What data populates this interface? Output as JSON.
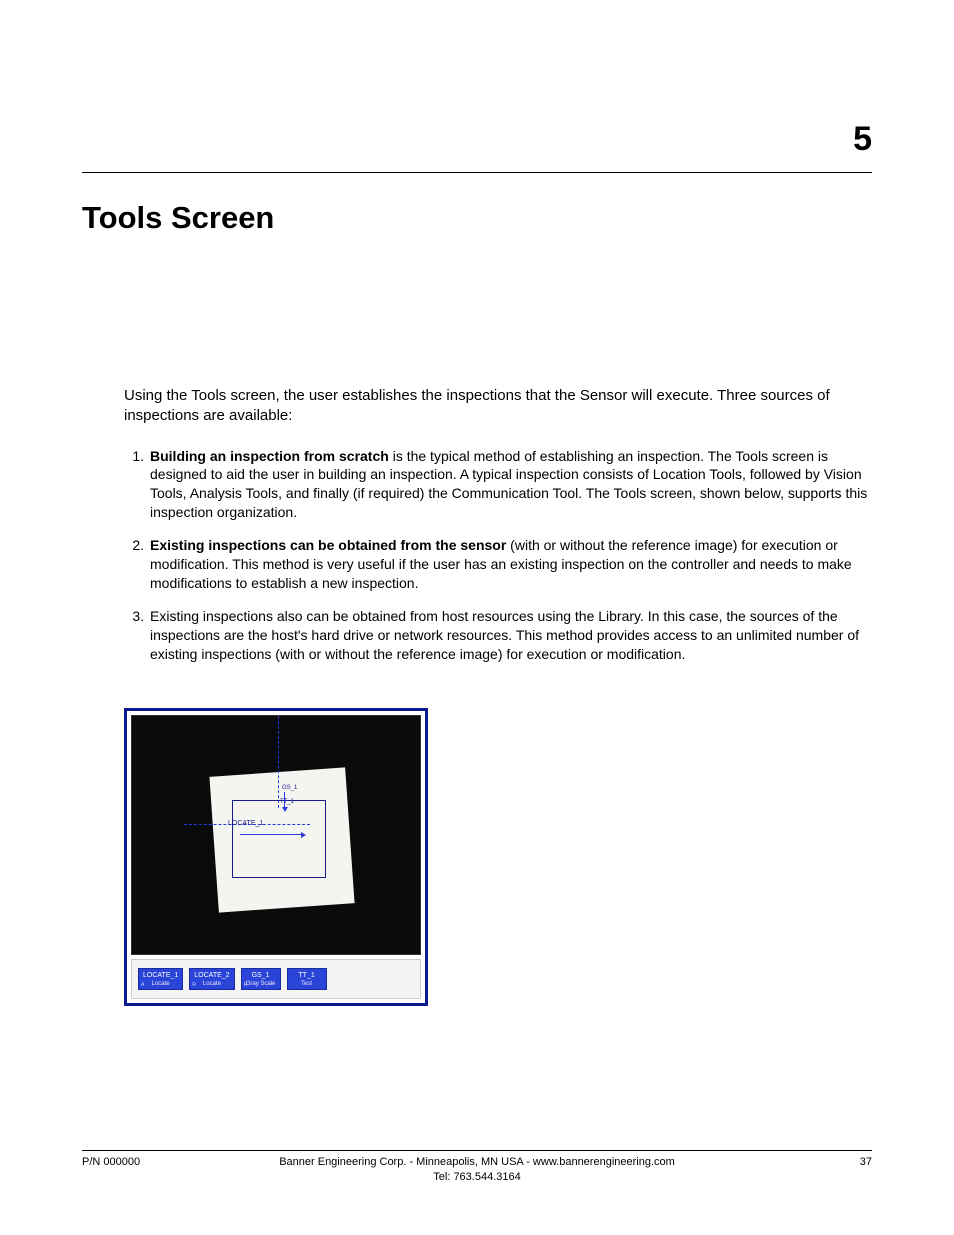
{
  "chapter_number": "5",
  "heading": "Tools Screen",
  "intro": "Using the Tools screen, the user establishes the inspections that the Sensor will execute. Three sources of inspections are available:",
  "sources": [
    {
      "bold": "Building an inspection from scratch",
      "rest": " is the typical method of establishing an inspection. The Tools screen is designed to aid the user in building an inspection. A typical inspection consists of Location Tools, followed by Vision Tools, Analysis Tools, and finally (if required) the Communication Tool. The Tools screen, shown below, supports this inspection organization."
    },
    {
      "bold": "Existing inspections can be obtained from the sensor",
      "rest": " (with or without the reference image) for execution or modification. This method is very useful if the user has an existing inspection on the controller and needs to make modifications to establish a new inspection."
    },
    {
      "bold": "",
      "rest": "Existing inspections also can be obtained from host resources using the Library. In this case, the sources of the inspections are the host's hard drive or network resources. This method provides access to an unlimited number of existing inspections (with or without the reference image) for execution or modification."
    }
  ],
  "figure": {
    "overlay_labels": {
      "locate": "LOCATE_1",
      "gs": "GS_1",
      "tt": "TT_1"
    },
    "tool_buttons": [
      {
        "name": "LOCATE_1",
        "sub": "Locate",
        "corner": "A"
      },
      {
        "name": "LOCATE_2",
        "sub": "Locate",
        "corner": "R"
      },
      {
        "name": "GS_1",
        "sub": "Gray Scale",
        "corner": "R"
      },
      {
        "name": "TT_1",
        "sub": "Test",
        "corner": ""
      }
    ]
  },
  "footer": {
    "pn": "P/N 000000",
    "center_line1": "Banner Engineering Corp. - Minneapolis, MN USA - www.bannerengineering.com",
    "center_line2": "Tel: 763.544.3164",
    "page": "37"
  }
}
